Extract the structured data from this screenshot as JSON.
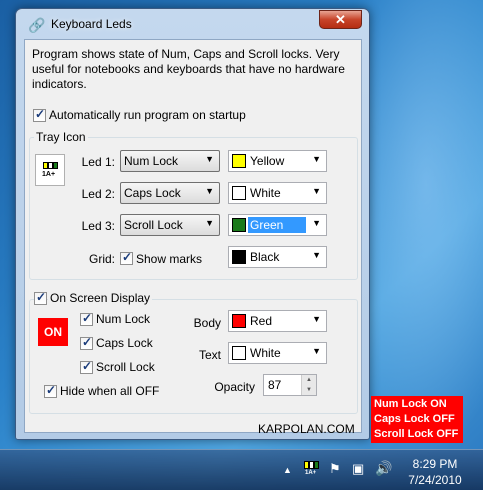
{
  "window": {
    "title": "Keyboard Leds",
    "close_glyph": "✕",
    "description": "Program shows state of Num, Caps and Scroll locks. Very useful for notebooks and keyboards that have no hardware indicators.",
    "autorun_label": "Automatically run program on startup",
    "autorun_checked": true,
    "tray_group_title": "Tray Icon",
    "tray_preview_text": "1A+",
    "leds": [
      {
        "label": "Led 1:",
        "lock": "Num Lock",
        "color_name": "Yellow",
        "color": "#ffff00"
      },
      {
        "label": "Led 2:",
        "lock": "Caps Lock",
        "color_name": "White",
        "color": "#ffffff"
      },
      {
        "label": "Led 3:",
        "lock": "Scroll Lock",
        "color_name": "Green",
        "color": "#1a7a1a"
      }
    ],
    "grid_label": "Grid:",
    "show_marks_label": "Show marks",
    "grid_color_name": "Black",
    "grid_color": "#000000",
    "osd_group_title": "On Screen Display",
    "osd_badge_text": "ON",
    "osd_num_lock": "Num Lock",
    "osd_caps_lock": "Caps Lock",
    "osd_scroll_lock": "Scroll Lock",
    "hide_label": "Hide when all OFF",
    "body_label": "Body",
    "body_color_name": "Red",
    "body_color": "#ff0000",
    "text_label": "Text",
    "text_color_name": "White",
    "text_color": "#ffffff",
    "opacity_label": "Opacity",
    "opacity_value": "87",
    "footer": "KARPOLAN.COM"
  },
  "osd_overlay": {
    "lines": [
      "Num Lock ON",
      "Caps Lock OFF",
      "Scroll Lock OFF"
    ]
  },
  "taskbar": {
    "tray_icon_text": "1A+",
    "time": "8:29 PM",
    "date": "7/24/2010"
  }
}
